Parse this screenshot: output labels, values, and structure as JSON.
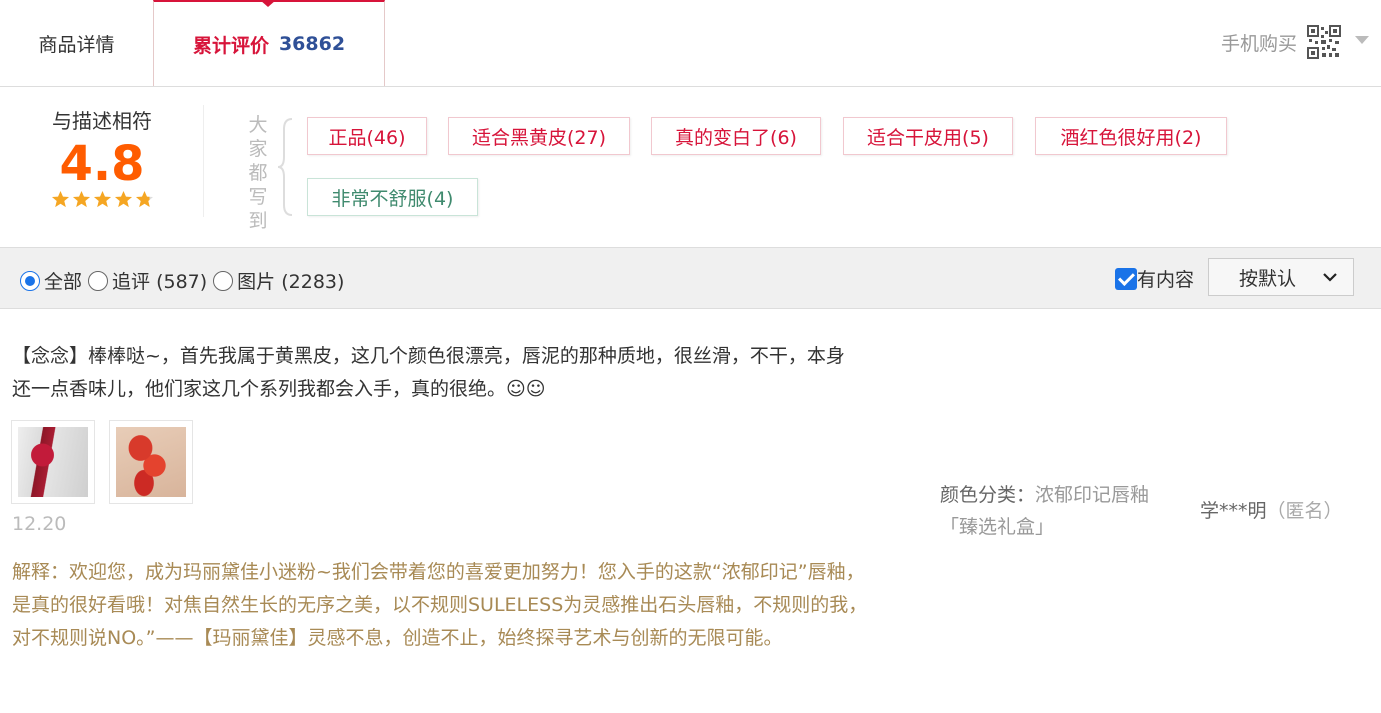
{
  "tabs": {
    "detail_label": "商品详情",
    "reviews_label": "累计评价",
    "reviews_count": "36862",
    "mobile_buy": "手机购买"
  },
  "rating": {
    "label": "与描述相符",
    "score": "4.8",
    "stars": 4.8
  },
  "tags": {
    "everyone_says": "大家都写到",
    "items": [
      {
        "label": "正品(46)",
        "sentiment": "positive"
      },
      {
        "label": "适合黑黄皮(27)",
        "sentiment": "positive"
      },
      {
        "label": "真的变白了(6)",
        "sentiment": "positive"
      },
      {
        "label": "适合干皮用(5)",
        "sentiment": "positive"
      },
      {
        "label": "酒红色很好用(2)",
        "sentiment": "positive"
      },
      {
        "label": "非常不舒服(4)",
        "sentiment": "negative"
      }
    ]
  },
  "filter": {
    "all": "全部",
    "followup": "追评",
    "followup_count": "(587)",
    "pics": "图片",
    "pics_count": "(2283)",
    "selected": "全部",
    "has_content": "有内容",
    "has_content_checked": true,
    "sort_label": "按默认"
  },
  "review": {
    "text": "【念念】棒棒哒~，首先我属于黄黑皮，这几个颜色很漂亮，唇泥的那种质地，很丝滑，不干，本身还一点香味儿，他们家这几个系列我都会入手，真的很绝。☺☺",
    "date": "12.20",
    "reply": "解释：欢迎您，成为玛丽黛佳小迷粉~我们会带着您的喜爱更加努力！您入手的这款“浓郁印记”唇釉，是真的很好看哦！对焦自然生长的无序之美，以不规则SULELESS为灵感推出石头唇釉，不规则的我，对不规则说NO。”——【玛丽黛佳】灵感不息，创造不止，始终探寻艺术与创新的无限可能。",
    "sku_key": "颜色分类：",
    "sku_value": "浓郁印记唇釉「臻选礼盒」",
    "user_name": "学***明",
    "user_anon": "（匿名）"
  },
  "colors": {
    "accent_red": "#d7143a",
    "count_blue": "#2f5097",
    "score_orange": "#ff5c00",
    "star_gold": "#f5a623",
    "reply_brown": "#a88a55"
  },
  "icons": [
    "qr-code-icon",
    "chevron-down-icon",
    "star-icon",
    "brace-icon"
  ]
}
